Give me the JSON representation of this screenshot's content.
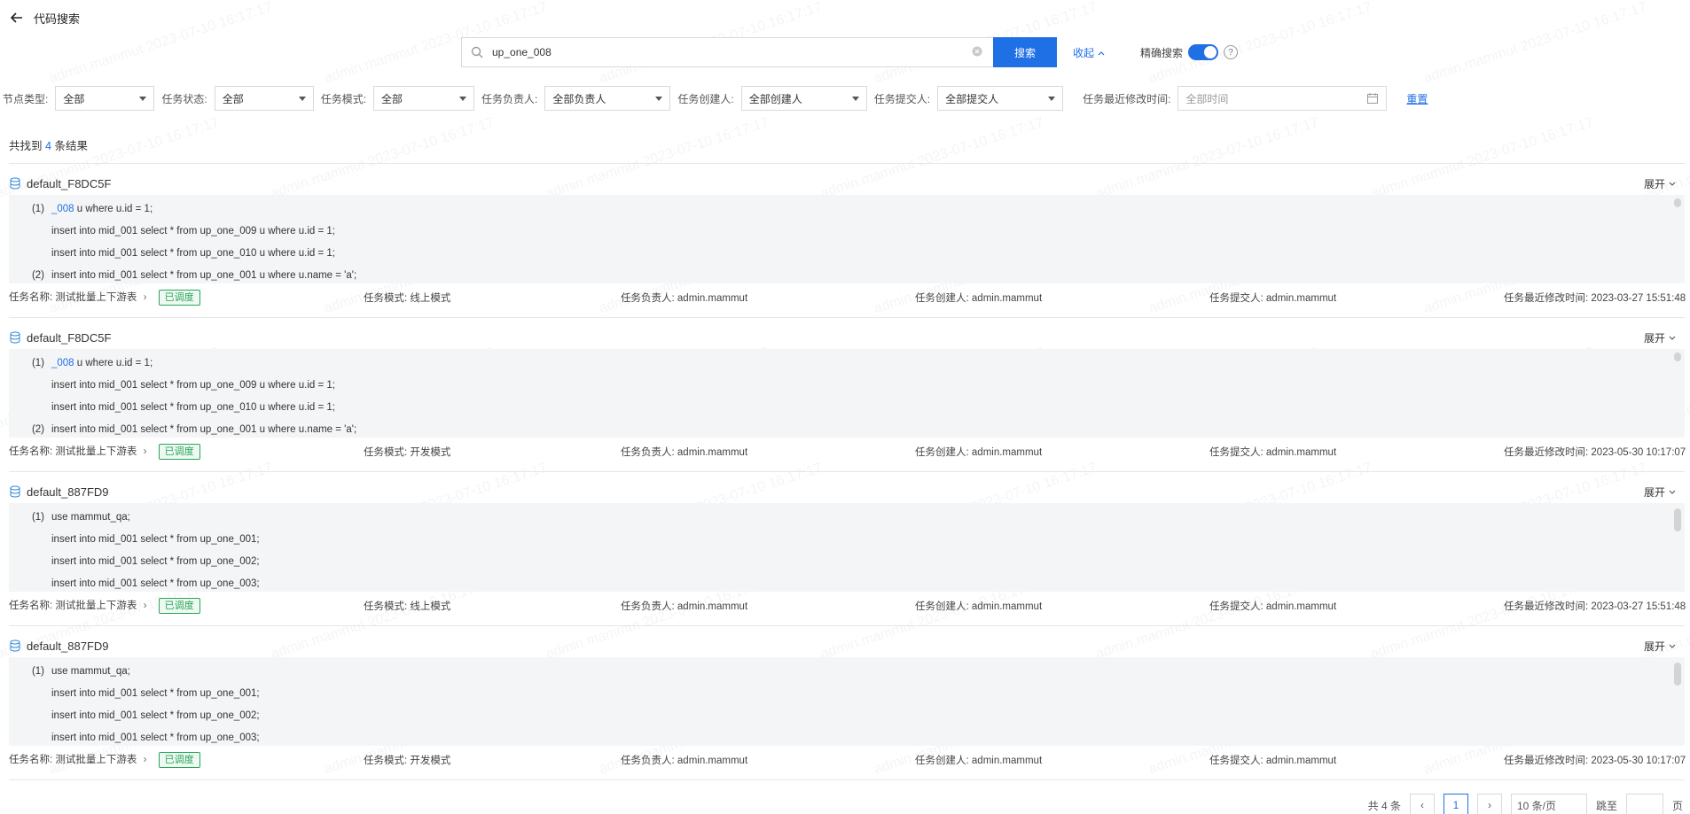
{
  "header": {
    "title": "代码搜索",
    "back_icon": "arrow-left-icon"
  },
  "search": {
    "value": "up_one_008",
    "button_label": "搜索",
    "collapse_label": "收起",
    "precise_label": "精确搜索"
  },
  "filters": [
    {
      "label": "节点类型:",
      "value": "全部"
    },
    {
      "label": "任务状态:",
      "value": "全部"
    },
    {
      "label": "任务模式:",
      "value": "全部"
    },
    {
      "label": "任务负责人:",
      "value": "全部负责人"
    },
    {
      "label": "任务创建人:",
      "value": "全部创建人"
    },
    {
      "label": "任务提交人:",
      "value": "全部提交人"
    }
  ],
  "date_filter": {
    "label": "任务最近修改时间:",
    "placeholder": "全部时间"
  },
  "reset_label": "重置",
  "summary": {
    "prefix": "共找到",
    "count": "4",
    "suffix": "条结果"
  },
  "results": [
    {
      "name": "default_F8DC5F",
      "expand_label": "展开",
      "lines": [
        {
          "num": "(1)",
          "hl": "_008",
          "text": " u where u.id = 1;"
        },
        {
          "num": "",
          "hl": "",
          "text": "insert into mid_001 select * from up_one_009 u where u.id = 1;"
        },
        {
          "num": "",
          "hl": "",
          "text": "insert into mid_001 select * from up_one_010 u where u.id = 1;"
        },
        {
          "num": "(2)",
          "hl": "",
          "text": "insert into mid_001 select * from up_one_001 u where u.name = 'a';"
        }
      ],
      "meta": {
        "task_name_label": "任务名称:",
        "task_name": "测试批量上下游表",
        "status_tag": "已调度",
        "mode_label": "任务模式:",
        "mode": "线上模式",
        "owner_label": "任务负责人:",
        "owner": "admin.mammut",
        "creator_label": "任务创建人:",
        "creator": "admin.mammut",
        "submitter_label": "任务提交人:",
        "submitter": "admin.mammut",
        "modified_label": "任务最近修改时间:",
        "modified": "2023-03-27 15:51:48"
      }
    },
    {
      "name": "default_F8DC5F",
      "expand_label": "展开",
      "lines": [
        {
          "num": "(1)",
          "hl": "_008",
          "text": " u where u.id = 1;"
        },
        {
          "num": "",
          "hl": "",
          "text": "insert into mid_001 select * from up_one_009 u where u.id = 1;"
        },
        {
          "num": "",
          "hl": "",
          "text": "insert into mid_001 select * from up_one_010 u where u.id = 1;"
        },
        {
          "num": "(2)",
          "hl": "",
          "text": "insert into mid_001 select * from up_one_001 u where u.name = 'a';"
        }
      ],
      "meta": {
        "task_name_label": "任务名称:",
        "task_name": "测试批量上下游表",
        "status_tag": "已调度",
        "mode_label": "任务模式:",
        "mode": "开发模式",
        "owner_label": "任务负责人:",
        "owner": "admin.mammut",
        "creator_label": "任务创建人:",
        "creator": "admin.mammut",
        "submitter_label": "任务提交人:",
        "submitter": "admin.mammut",
        "modified_label": "任务最近修改时间:",
        "modified": "2023-05-30 10:17:07"
      }
    },
    {
      "name": "default_887FD9",
      "expand_label": "展开",
      "lines": [
        {
          "num": "(1)",
          "hl": "",
          "text": "use mammut_qa;"
        },
        {
          "num": "",
          "hl": "",
          "text": "insert into mid_001 select * from up_one_001;"
        },
        {
          "num": "",
          "hl": "",
          "text": "insert into mid_001 select * from up_one_002;"
        },
        {
          "num": "",
          "hl": "",
          "text": "insert into mid_001 select * from up_one_003;"
        }
      ],
      "meta": {
        "task_name_label": "任务名称:",
        "task_name": "测试批量上下游表",
        "status_tag": "已调度",
        "mode_label": "任务模式:",
        "mode": "线上模式",
        "owner_label": "任务负责人:",
        "owner": "admin.mammut",
        "creator_label": "任务创建人:",
        "creator": "admin.mammut",
        "submitter_label": "任务提交人:",
        "submitter": "admin.mammut",
        "modified_label": "任务最近修改时间:",
        "modified": "2023-03-27 15:51:48"
      }
    },
    {
      "name": "default_887FD9",
      "expand_label": "展开",
      "lines": [
        {
          "num": "(1)",
          "hl": "",
          "text": "use mammut_qa;"
        },
        {
          "num": "",
          "hl": "",
          "text": "insert into mid_001 select * from up_one_001;"
        },
        {
          "num": "",
          "hl": "",
          "text": "insert into mid_001 select * from up_one_002;"
        },
        {
          "num": "",
          "hl": "",
          "text": "insert into mid_001 select * from up_one_003;"
        }
      ],
      "meta": {
        "task_name_label": "任务名称:",
        "task_name": "测试批量上下游表",
        "status_tag": "已调度",
        "mode_label": "任务模式:",
        "mode": "开发模式",
        "owner_label": "任务负责人:",
        "owner": "admin.mammut",
        "creator_label": "任务创建人:",
        "creator": "admin.mammut",
        "submitter_label": "任务提交人:",
        "submitter": "admin.mammut",
        "modified_label": "任务最近修改时间:",
        "modified": "2023-05-30 10:17:07"
      }
    }
  ],
  "pagination": {
    "total": "共 4 条",
    "current": "1",
    "page_size": "10 条/页",
    "jump_prefix": "跳至",
    "jump_suffix": "页"
  },
  "watermark": "admin.mammut 2023-07-10 16:17:17",
  "colors": {
    "accent": "#1f6fe5",
    "tag_green": "#2aa55a",
    "code_bg": "#f4f5f7"
  }
}
